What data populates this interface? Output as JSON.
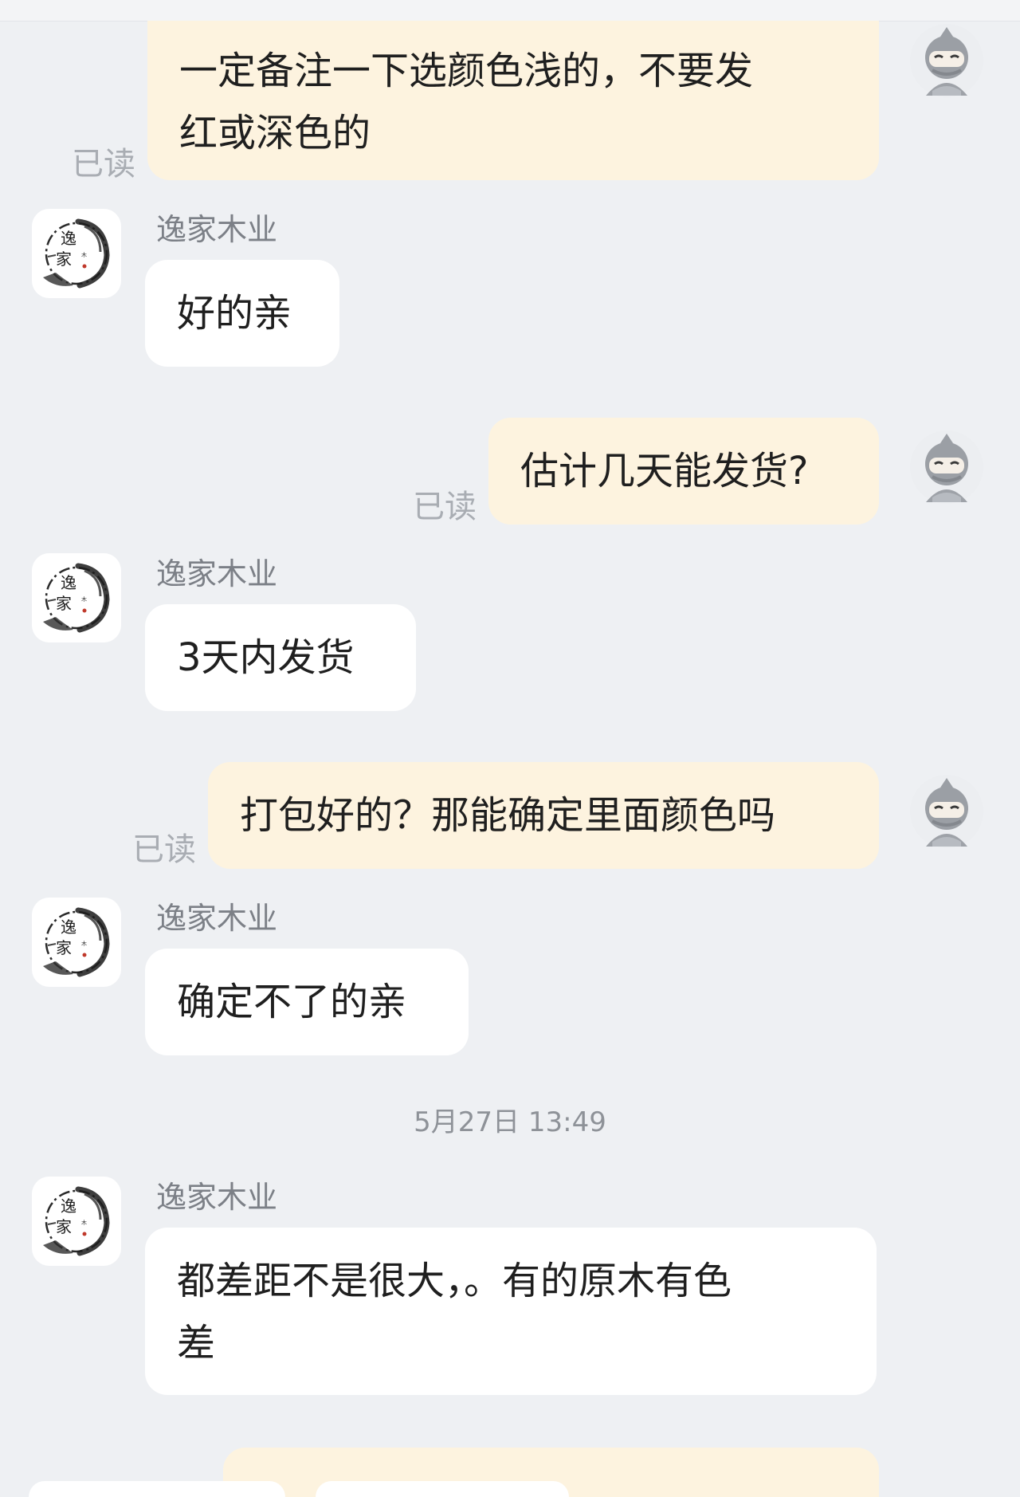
{
  "chat": {
    "shop_name": "逸家木业",
    "read_label": "已读",
    "messages": [
      {
        "text": "一定备注一下选颜色浅的，不要发\n红或深色的"
      },
      {
        "text": "好的亲"
      },
      {
        "text": "估计几天能发货?"
      },
      {
        "text": "3天内发货"
      },
      {
        "text": "打包好的？那能确定里面颜色吗"
      },
      {
        "text": "确定不了的亲"
      },
      {
        "text": "都差距不是很大，。有的原木有色\n差"
      }
    ],
    "timestamp": "5月27日 13:49"
  },
  "icons": {
    "user_avatar": "ninja-avatar-icon",
    "shop_avatar": "ink-logo-icon"
  },
  "colors": {
    "background": "#eef0f3",
    "outgoing_bubble": "#fdf3df",
    "incoming_bubble": "#ffffff",
    "read_text": "#a9adb3",
    "sender_text": "#7c8087"
  }
}
